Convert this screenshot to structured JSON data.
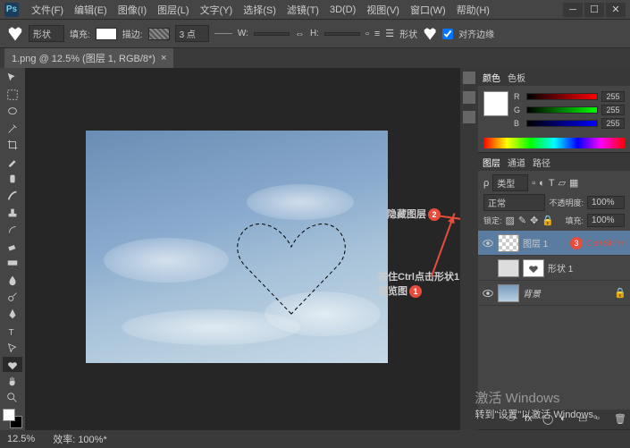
{
  "menu": [
    "文件(F)",
    "编辑(E)",
    "图像(I)",
    "图层(L)",
    "文字(Y)",
    "选择(S)",
    "滤镜(T)",
    "3D(D)",
    "视图(V)",
    "窗口(W)",
    "帮助(H)"
  ],
  "optbar": {
    "shape_label": "形状",
    "fill_label": "填充:",
    "stroke_label": "描边:",
    "stroke_val": "3 点",
    "w_label": "W:",
    "h_label": "H:",
    "shape2_label": "形状",
    "align_label": "对齐边缘"
  },
  "tab": {
    "title": "1.png @ 12.5% (图层 1, RGB/8*)"
  },
  "color_panel": {
    "tab1": "颜色",
    "tab2": "色板",
    "r": "R",
    "g": "G",
    "b": "B",
    "val": "255"
  },
  "layers_panel": {
    "tab1": "图层",
    "tab2": "通道",
    "tab3": "路径",
    "kind": "类型",
    "blend": "正常",
    "opacity_label": "不透明度:",
    "opacity_val": "100%",
    "lock_label": "锁定:",
    "fill_label": "填充:",
    "fill_val": "100%",
    "layer1": "图层 1",
    "layer1_extra": "Ctrl+Shift+I",
    "layer2": "形状 1",
    "layer3": "背景"
  },
  "annotations": {
    "a1": "按住Ctrl点击形状1缩览图",
    "b1": "1",
    "a2": "隐藏图层",
    "b2": "2",
    "b3": "3"
  },
  "status": {
    "zoom": "12.5%",
    "doc": "效率: 100%*"
  },
  "watermark": {
    "t1": "激活 Windows",
    "t2": "转到\"设置\"以激活 Windows。"
  }
}
